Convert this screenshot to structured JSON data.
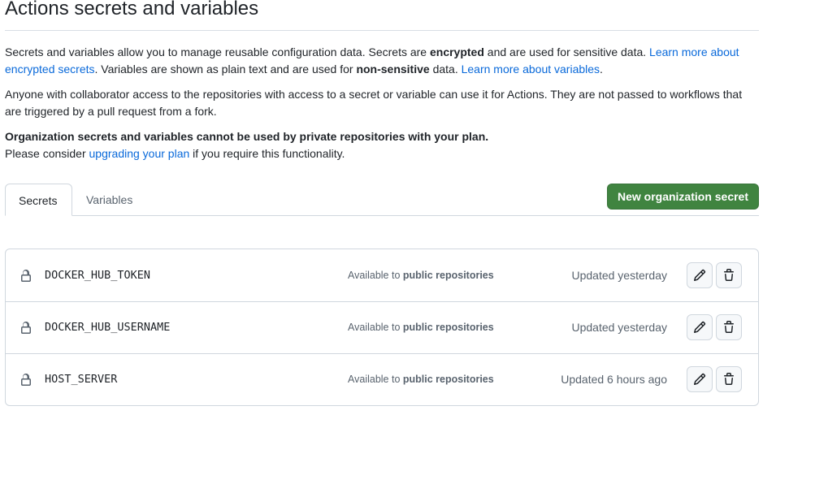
{
  "page": {
    "title": "Actions secrets and variables"
  },
  "intro": {
    "p1_a": "Secrets and variables allow you to manage reusable configuration data. Secrets are ",
    "p1_b": "encrypted",
    "p1_c": " and are used for sensitive data. ",
    "p1_link1": "Learn more about encrypted secrets",
    "p1_d": ". Variables are shown as plain text and are used for ",
    "p1_e": "non-sensitive",
    "p1_f": " data. ",
    "p1_link2": "Learn more about variables",
    "p1_g": ".",
    "p2": "Anyone with collaborator access to the repositories with access to a secret or variable can use it for Actions. They are not passed to workflows that are triggered by a pull request from a fork.",
    "p3_bold": "Organization secrets and variables cannot be used by private repositories with your plan.",
    "p3_a": "Please consider ",
    "p3_link": "upgrading your plan",
    "p3_b": " if you require this functionality."
  },
  "tabs": {
    "secrets": "Secrets",
    "variables": "Variables"
  },
  "new_secret_button": "New organization secret",
  "secrets": [
    {
      "name": "DOCKER_HUB_TOKEN",
      "available_prefix": "Available to ",
      "available_scope": "public repositories",
      "updated": "Updated yesterday"
    },
    {
      "name": "DOCKER_HUB_USERNAME",
      "available_prefix": "Available to ",
      "available_scope": "public repositories",
      "updated": "Updated yesterday"
    },
    {
      "name": "HOST_SERVER",
      "available_prefix": "Available to ",
      "available_scope": "public repositories",
      "updated": "Updated 6 hours ago"
    }
  ],
  "colors": {
    "primary_button": "#408440",
    "link": "#0969da",
    "border": "#d0d7de",
    "muted_text": "#59636e"
  },
  "icons": {
    "row_icon": "lock-icon",
    "edit": "pencil-icon",
    "delete": "trash-icon"
  }
}
